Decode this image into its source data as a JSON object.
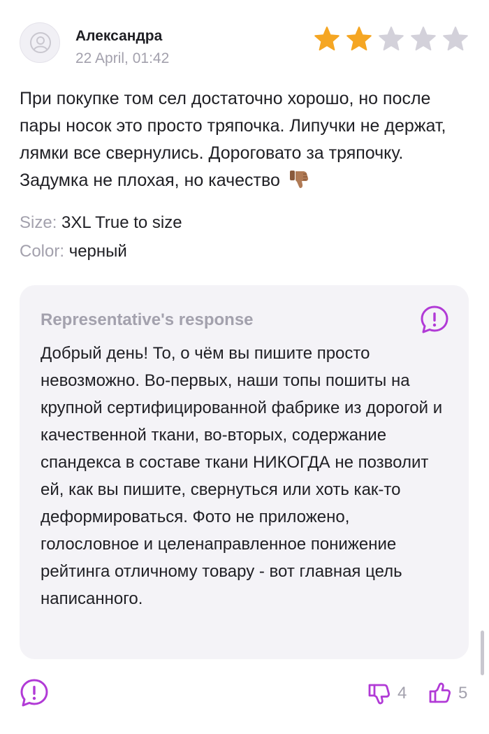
{
  "review": {
    "author": "Александра",
    "date": "22 April, 01:42",
    "rating": 2,
    "rating_max": 5,
    "text": "При покупке том сел достаточно хорошо, но после пары носок это просто тряпочка. Липучки не держат, лямки все свернулись. Дороговато за тряпочку. Задумка не плохая, но качество",
    "emoji": "thumbs-down-emoji",
    "size_label": "Size:",
    "size_value": "3XL True to size",
    "color_label": "Color:",
    "color_value": "черный"
  },
  "response": {
    "title": "Representative's response",
    "text": "Добрый день! То, о чём вы пишите просто невозможно. Во-первых, наши топы пошиты на крупной сертифицированной фабрике из дорогой и качественной ткани, во-вторых, содержание спандекса в составе ткани НИКОГДА не позволит ей, как вы пишите, свернуться или хоть как-то деформироваться. Фото не приложено, голословное и целенаправленное понижение рейтинга отличному товару - вот главная цель написанного."
  },
  "footer": {
    "dislikes": "4",
    "likes": "5"
  },
  "colors": {
    "star_filled": "#f5a623",
    "star_empty": "#d3d1da",
    "accent": "#b13ad6",
    "muted": "#a3a1ad"
  },
  "icons": {
    "avatar": "user-icon",
    "report": "exclamation-bubble-icon",
    "dislike": "thumbs-down-icon",
    "like": "thumbs-up-icon"
  }
}
